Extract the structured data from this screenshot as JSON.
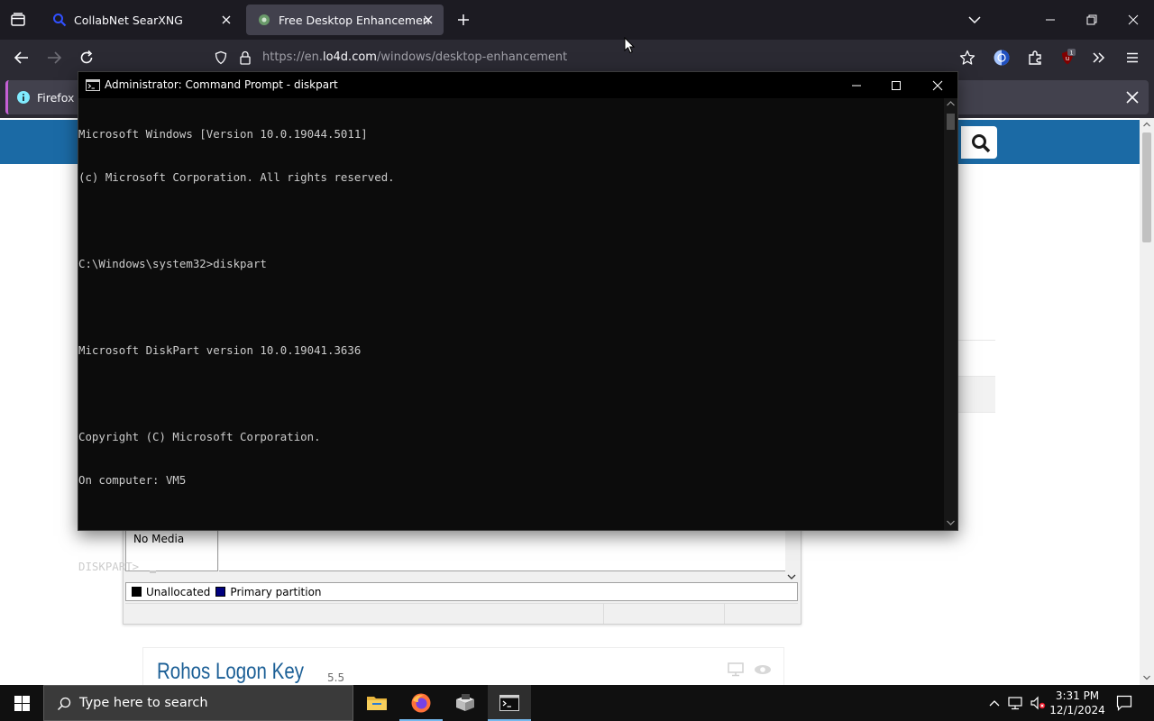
{
  "browser": {
    "tabs": [
      {
        "title": "CollabNet SearXNG",
        "active": false
      },
      {
        "title": "Free Desktop Enhancement Sof",
        "active": true
      }
    ],
    "url": {
      "prefix": "https://en.",
      "host": "lo4d.com",
      "path": "/windows/desktop-enhancement"
    },
    "notification": {
      "text": "Firefox a"
    }
  },
  "page": {
    "disk": {
      "media_label": "No Media",
      "legend": [
        {
          "label": "Unallocated",
          "color": "#000000"
        },
        {
          "label": "Primary partition",
          "color": "#00007f"
        }
      ]
    },
    "article": {
      "title": "Rohos Logon Key",
      "version": "5.5"
    }
  },
  "cmd": {
    "title": "Administrator: Command Prompt - diskpart",
    "lines": [
      "Microsoft Windows [Version 10.0.19044.5011]",
      "(c) Microsoft Corporation. All rights reserved.",
      "",
      "C:\\Windows\\system32>diskpart",
      "",
      "Microsoft DiskPart version 10.0.19041.3636",
      "",
      "Copyright (C) Microsoft Corporation.",
      "On computer: VM5",
      "",
      "DISKPART> "
    ]
  },
  "taskbar": {
    "search_placeholder": "Type here to search",
    "time": "3:31 PM",
    "date": "12/1/2024"
  },
  "colors": {
    "accent": "#1b6aa5",
    "taskbar_indicator": "#76b9ed",
    "notification_accent": "#c45fd4"
  }
}
